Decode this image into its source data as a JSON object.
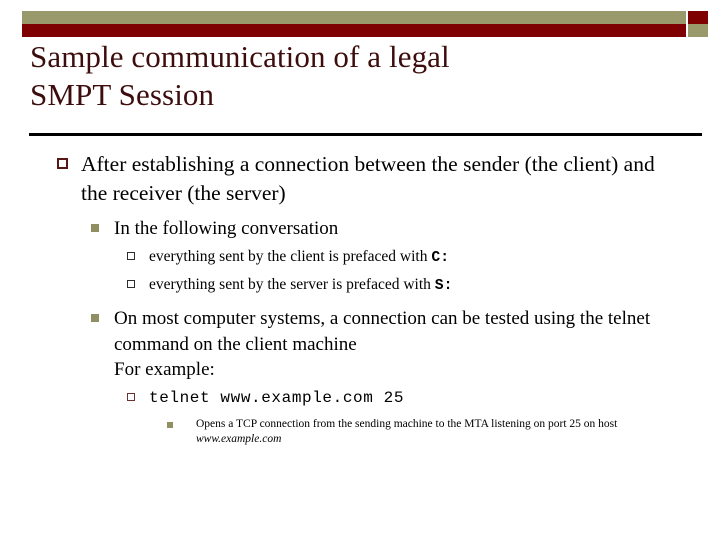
{
  "slide": {
    "title": "Sample communication of a legal SMPT Session",
    "title_line1": "Sample communication of a legal",
    "title_line2": "SMPT Session"
  },
  "theme": {
    "olive": "#99996b",
    "maroon": "#7f0000",
    "title_color": "#3d0d0d",
    "body_color": "#000000",
    "background": "#ffffff",
    "rule_color": "#000000"
  },
  "decoration": {
    "top_bar_name": "olive-bar",
    "top_cap_name": "maroon-cap",
    "bottom_bar_name": "maroon-bar",
    "bottom_cap_name": "olive-cap"
  },
  "content": {
    "bullet1": {
      "marker": "hollow-square-maroon",
      "text": "After establishing a connection between the sender (the client) and the receiver (the server)"
    },
    "bullet2a": {
      "marker": "filled-square-olive",
      "text": "In the following conversation"
    },
    "bullet3a": {
      "marker": "hollow-square-dark",
      "text_before": "everything sent by the client is prefaced with ",
      "code": "C:"
    },
    "bullet3b": {
      "marker": "hollow-square-dark",
      "text_before": "everything sent by the server is prefaced with ",
      "code": "S:"
    },
    "bullet2b": {
      "marker": "filled-square-olive",
      "text": "On most computer systems, a connection can be tested using the telnet command on the client machine",
      "subline": "For example:"
    },
    "bullet3c": {
      "marker": "hollow-square-maroon",
      "command": "telnet www.example.com 25"
    },
    "bullet4a": {
      "marker": "filled-square-olive",
      "text_before": "Opens a TCP connection from the sending machine to the MTA listening on port 25 on host ",
      "host": "www.example.com"
    }
  }
}
